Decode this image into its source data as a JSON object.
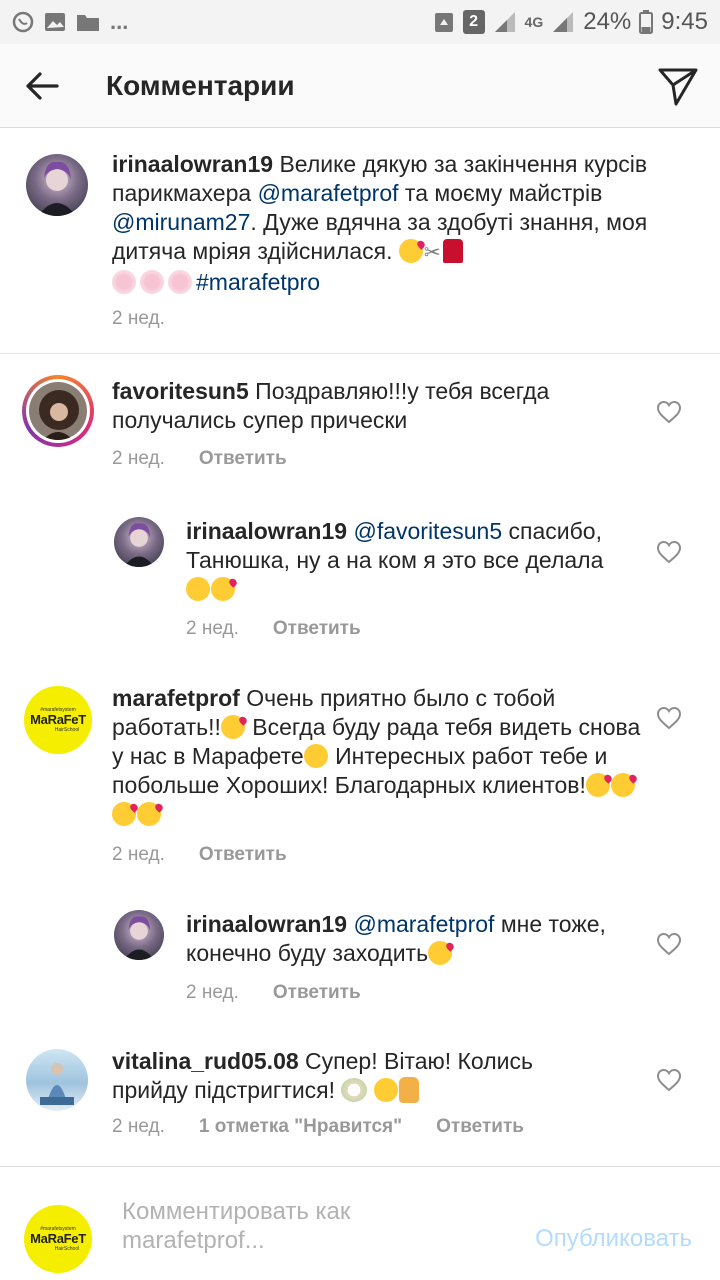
{
  "status_bar": {
    "notification_count": "2",
    "network": "4G",
    "battery": "24%",
    "time": "9:45",
    "dots": "..."
  },
  "header": {
    "title": "Комментарии"
  },
  "comments": [
    {
      "username": "irinaalowran19",
      "text_1": "Велике дякую за закінчення курсів парикмахера ",
      "mention_1": "@marafetprof",
      "text_2": " та моєму майстрів ",
      "mention_2": "@mirunam27",
      "text_3": ".  Дуже вдячна за здобуті знання,  моя дитяча мріяя здійснилася. ",
      "hashtag": "#marafetpro",
      "time": "2 нед."
    },
    {
      "username": "favoritesun5",
      "text": "Поздравляю!!!у тебя всегда получались супер прически",
      "time": "2 нед.",
      "reply_label": "Ответить"
    },
    {
      "username": "irinaalowran19",
      "mention": "@favoritesun5",
      "text": " спасибо, Танюшка,  ну а на ком я это все делала",
      "time": "2 нед.",
      "reply_label": "Ответить"
    },
    {
      "username": "marafetprof",
      "text_1": "Очень приятно было с тобой работать!!",
      "text_2": " Всегда буду рада тебя видеть снова у нас в Марафете",
      "text_3": " Интересных работ тебе и побольше Хороших! Благодарных клиентов!",
      "time": "2 нед.",
      "reply_label": "Ответить"
    },
    {
      "username": "irinaalowran19",
      "mention": "@marafetprof",
      "text": " мне тоже, конечно буду заходить",
      "time": "2 нед.",
      "reply_label": "Ответить"
    },
    {
      "username": "vitalina_rud05.08",
      "text": "Супер! Вітаю!  Колись прийду підстригтися! ",
      "time": "2 нед.",
      "likes": "1 отметка \"Нравится\"",
      "reply_label": "Ответить"
    }
  ],
  "logo": {
    "small_text": "#marafetsystem",
    "main_text": "MaRaFeT",
    "sub_text": "HairSchool"
  },
  "input": {
    "placeholder": "Комментировать как marafetprof...",
    "publish_label": "Опубликовать"
  },
  "colors": {
    "mention": "#003569",
    "publish_disabled": "#b3dbff",
    "logo_yellow": "#f5ee00"
  }
}
